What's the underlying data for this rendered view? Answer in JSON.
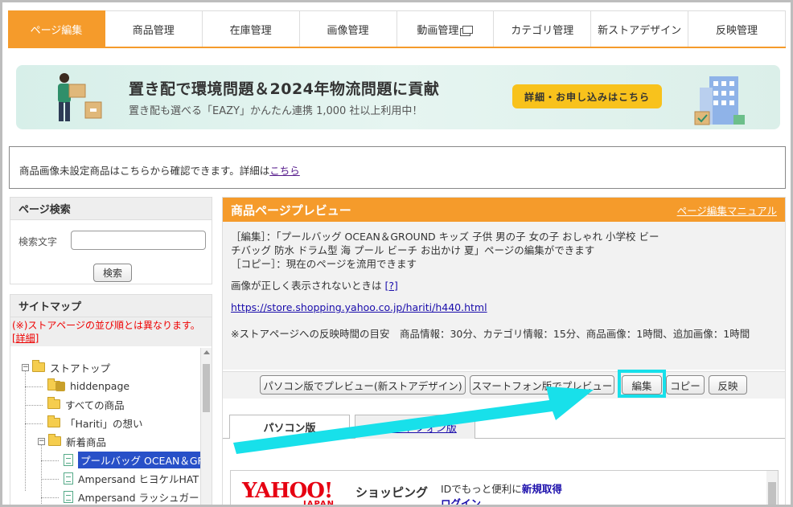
{
  "tabs": [
    {
      "label": "ページ編集"
    },
    {
      "label": "商品管理"
    },
    {
      "label": "在庫管理"
    },
    {
      "label": "画像管理"
    },
    {
      "label": "動画管理"
    },
    {
      "label": "カテゴリ管理"
    },
    {
      "label": "新ストアデザイン"
    },
    {
      "label": "反映管理"
    }
  ],
  "banner": {
    "title": "置き配で環境問題＆2024年物流問題に貢献",
    "subtitle": "置き配も選べる「EAZY」かんたん連携 1,000 社以上利用中！",
    "button": "詳細・お申し込みはこちら"
  },
  "notice": {
    "text": "商品画像未設定商品はこちらから確認できます。詳細は",
    "link": "こちら"
  },
  "search": {
    "heading": "ページ検索",
    "label": "検索文字",
    "input_value": "",
    "button": "検索"
  },
  "sitemap": {
    "heading": "サイトマップ",
    "note": "(※)ストアページの並び順とは異なります。",
    "note_link": "[詳細]",
    "nodes": [
      {
        "label": "ストアトップ"
      },
      {
        "label": "hiddenpage"
      },
      {
        "label": "すべての商品"
      },
      {
        "label": "「Hariti」の想い"
      },
      {
        "label": "新着商品"
      },
      {
        "label": "プールバッグ OCEAN＆GR"
      },
      {
        "label": "Ampersand ヒヨケルHAT"
      },
      {
        "label": "Ampersand ラッシュガー"
      }
    ]
  },
  "preview": {
    "heading": "商品ページプレビュー",
    "manual_link": "ページ編集マニュアル",
    "line1": "［編集］：「プールバッグ OCEAN＆GROUND キッズ 子供 男の子 女の子 おしゃれ 小学校 ビー",
    "line2": "チバッグ 防水 ドラム型 海 プール ビーチ お出かけ 夏」ページの編集ができます",
    "line3": "［コピー］：現在のページを流用できます",
    "help_text": "画像が正しく表示されないときは",
    "help_link": "[?]",
    "url": "https://store.shopping.yahoo.co.jp/hariti/h440.html",
    "reflect_note": "※ストアページへの反映時間の目安　商品情報：30分、カテゴリ情報：15分、商品画像：1時間、追加画像：1時間",
    "buttons": {
      "pc_preview": "パソコン版でプレビュー(新ストアデザイン)",
      "sp_preview": "スマートフォン版でプレビュー",
      "edit": "編集",
      "copy": "コピー",
      "reflect": "反映"
    },
    "tab_pc": "パソコン版",
    "tab_sp": "スマートフォン版"
  },
  "yahoo": {
    "logo": "YAHOO!",
    "japan": "JAPAN",
    "shopping": "ショッピング",
    "id_text": "IDでもっと便利に",
    "register": "新規取得",
    "login": "ログイン"
  },
  "colors": {
    "accent": "#f59b2b",
    "highlight": "#18e0ea",
    "link": "#1a0dab"
  }
}
